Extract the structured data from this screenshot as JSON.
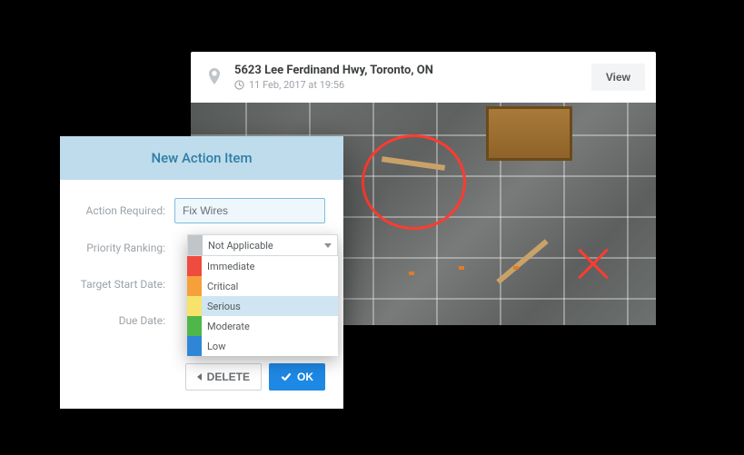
{
  "card": {
    "address": "5623 Lee Ferdinand Hwy, Toronto, ON",
    "timestamp": "11 Feb, 2017 at 19:56",
    "view_label": "View",
    "pin_icon": "map-pin-icon",
    "clock_icon": "clock-icon"
  },
  "modal": {
    "title": "New Action Item",
    "labels": {
      "action_required": "Action Required:",
      "priority_ranking": "Priority Ranking:",
      "target_start": "Target Start Date:",
      "due_date": "Due Date:"
    },
    "action_value": "Fix Wires",
    "dropdown": {
      "selected": "Not Applicable",
      "options": [
        {
          "label": "Immediate",
          "swatch": "sw-red"
        },
        {
          "label": "Critical",
          "swatch": "sw-orange"
        },
        {
          "label": "Serious",
          "swatch": "sw-yellow",
          "selected": true
        },
        {
          "label": "Moderate",
          "swatch": "sw-green"
        },
        {
          "label": "Low",
          "swatch": "sw-blue"
        }
      ]
    },
    "buttons": {
      "delete": "DELETE",
      "ok": "OK"
    }
  },
  "annotations": {
    "circle": "annotation-circle",
    "x": "annotation-x"
  }
}
